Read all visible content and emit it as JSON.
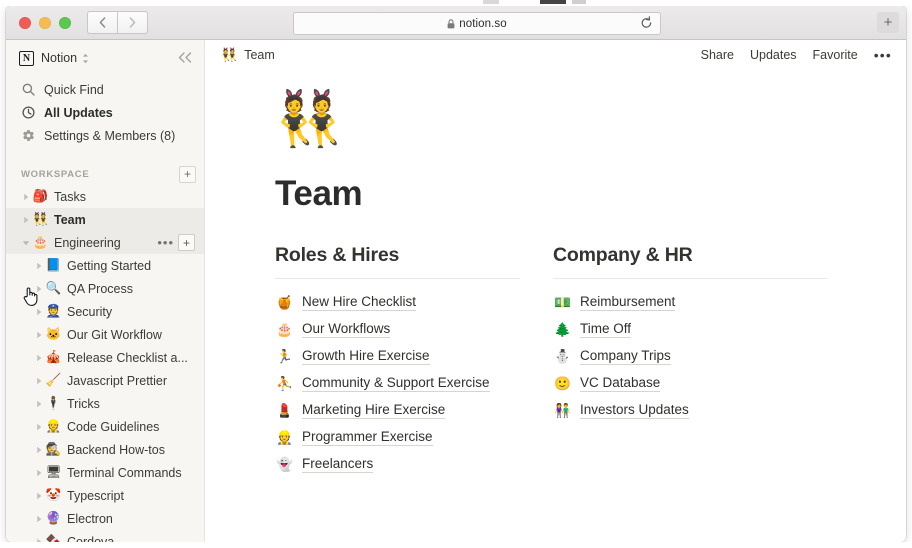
{
  "browser": {
    "url": "notion.so",
    "lock_icon": "lock-icon",
    "reload_icon": "reload-icon",
    "back_icon": "chevron-left-icon",
    "forward_icon": "chevron-right-icon",
    "new_tab_label": "+",
    "traffic_lights": [
      "close",
      "minimize",
      "zoom"
    ],
    "colors": {
      "close": "#f05b56",
      "minimize": "#f5bd4f",
      "zoom": "#5cc753"
    }
  },
  "sidebar": {
    "workspace_name": "Notion",
    "workspace_mark": "N",
    "collapse_icon": "double-chevron-left-icon",
    "nav": [
      {
        "label": "Quick Find",
        "icon": "search-icon",
        "bold": false
      },
      {
        "label": "All Updates",
        "icon": "clock-icon",
        "bold": true
      },
      {
        "label": "Settings & Members (8)",
        "icon": "gear-icon",
        "bold": false
      }
    ],
    "section_label": "WORKSPACE",
    "section_add_label": "+",
    "pages": [
      {
        "label": "Tasks",
        "emoji": "🎒",
        "indent": 0,
        "expanded": false,
        "selected": false,
        "hovered": false,
        "actions": false
      },
      {
        "label": "Team",
        "emoji": "👯",
        "indent": 0,
        "expanded": false,
        "selected": true,
        "hovered": false,
        "actions": false
      },
      {
        "label": "Engineering",
        "emoji": "🎂",
        "indent": 0,
        "expanded": true,
        "selected": false,
        "hovered": true,
        "actions": true
      },
      {
        "label": "Getting Started",
        "emoji": "📘",
        "indent": 1,
        "expanded": false,
        "selected": false,
        "hovered": false,
        "actions": false
      },
      {
        "label": "QA Process",
        "emoji": "🔍",
        "indent": 1,
        "expanded": false,
        "selected": false,
        "hovered": false,
        "actions": false
      },
      {
        "label": "Security",
        "emoji": "👮",
        "indent": 1,
        "expanded": false,
        "selected": false,
        "hovered": false,
        "actions": false
      },
      {
        "label": "Our Git Workflow",
        "emoji": "🐱",
        "indent": 1,
        "expanded": false,
        "selected": false,
        "hovered": false,
        "actions": false
      },
      {
        "label": "Release Checklist a...",
        "emoji": "🎪",
        "indent": 1,
        "expanded": false,
        "selected": false,
        "hovered": false,
        "actions": false
      },
      {
        "label": "Javascript Prettier",
        "emoji": "🧹",
        "indent": 1,
        "expanded": false,
        "selected": false,
        "hovered": false,
        "actions": false
      },
      {
        "label": "Tricks",
        "emoji": "🕴",
        "indent": 1,
        "expanded": false,
        "selected": false,
        "hovered": false,
        "actions": false
      },
      {
        "label": "Code Guidelines",
        "emoji": "👷",
        "indent": 1,
        "expanded": false,
        "selected": false,
        "hovered": false,
        "actions": false
      },
      {
        "label": "Backend How-tos",
        "emoji": "🕵",
        "indent": 1,
        "expanded": false,
        "selected": false,
        "hovered": false,
        "actions": false
      },
      {
        "label": "Terminal Commands",
        "emoji": "🖥",
        "indent": 1,
        "expanded": false,
        "selected": false,
        "hovered": false,
        "actions": false
      },
      {
        "label": "Typescript",
        "emoji": "🤡",
        "indent": 1,
        "expanded": false,
        "selected": false,
        "hovered": false,
        "actions": false
      },
      {
        "label": "Electron",
        "emoji": "🔮",
        "indent": 1,
        "expanded": false,
        "selected": false,
        "hovered": false,
        "actions": false
      },
      {
        "label": "Cordova",
        "emoji": "🍫",
        "indent": 1,
        "expanded": false,
        "selected": false,
        "hovered": false,
        "actions": false
      }
    ],
    "row_actions": {
      "more_label": "•••",
      "add_label": "+"
    },
    "cursor": "pointing-hand-cursor"
  },
  "topbar": {
    "breadcrumb_emoji": "👯",
    "breadcrumb_label": "Team",
    "actions": [
      "Share",
      "Updates",
      "Favorite"
    ],
    "more_label": "•••"
  },
  "page": {
    "icon": "👯",
    "title": "Team",
    "columns": [
      {
        "heading": "Roles & Hires",
        "items": [
          {
            "emoji": "🍯",
            "label": "New Hire Checklist"
          },
          {
            "emoji": "🎂",
            "label": "Our Workflows"
          },
          {
            "emoji": "🏃",
            "label": "Growth Hire Exercise"
          },
          {
            "emoji": "⛹",
            "label": "Community & Support Exercise"
          },
          {
            "emoji": "💄",
            "label": "Marketing Hire Exercise"
          },
          {
            "emoji": "👷",
            "label": "Programmer Exercise"
          },
          {
            "emoji": "👻",
            "label": "Freelancers"
          }
        ]
      },
      {
        "heading": "Company & HR",
        "items": [
          {
            "emoji": "💵",
            "label": "Reimbursement"
          },
          {
            "emoji": "🌲",
            "label": "Time Off"
          },
          {
            "emoji": "⛄",
            "label": "Company Trips"
          },
          {
            "emoji": "🙂",
            "label": "VC Database"
          },
          {
            "emoji": "👫",
            "label": "Investors Updates"
          }
        ]
      }
    ]
  }
}
